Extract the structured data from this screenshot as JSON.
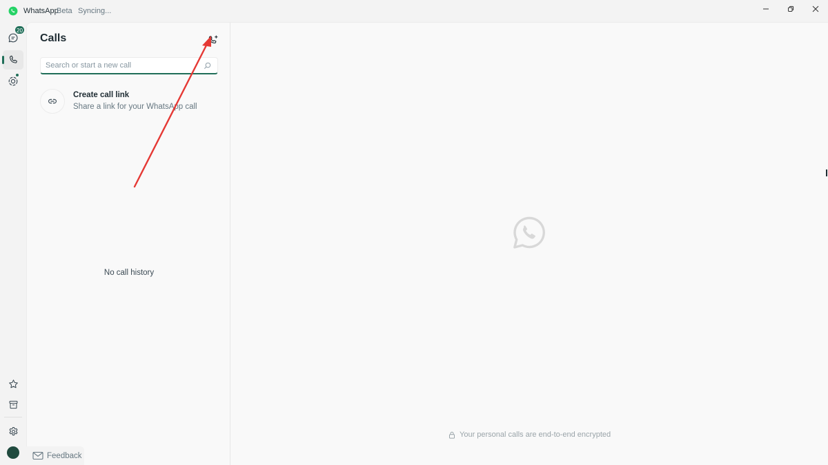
{
  "titlebar": {
    "app_name": "WhatsApp",
    "edition": "Beta",
    "status": "Syncing...",
    "controls": [
      "minimize",
      "restore",
      "close"
    ]
  },
  "rail": {
    "items": [
      {
        "name": "chats",
        "icon": "chat-icon",
        "badge": "20",
        "active": false
      },
      {
        "name": "calls",
        "icon": "phone-icon",
        "active": true
      },
      {
        "name": "status",
        "icon": "status-icon",
        "dot": true,
        "active": false
      }
    ],
    "bottom": [
      {
        "name": "starred",
        "icon": "star-icon"
      },
      {
        "name": "archived",
        "icon": "archive-icon"
      },
      {
        "name": "settings",
        "icon": "gear-icon"
      },
      {
        "name": "profile",
        "icon": "avatar"
      }
    ]
  },
  "calls_panel": {
    "title": "Calls",
    "new_call_icon": "phone-plus-icon",
    "search": {
      "value": "",
      "placeholder": "Search or start a new call"
    },
    "create_link": {
      "title": "Create call link",
      "subtitle": "Share a link for your WhatsApp call",
      "icon": "link-icon"
    },
    "empty_text": "No call history"
  },
  "feedback": {
    "label": "Feedback",
    "icon": "mail-icon"
  },
  "main": {
    "placeholder_icon": "whatsapp-logo-icon",
    "encryption_notice": "Your personal calls are end-to-end encrypted",
    "encryption_icon": "lock-icon"
  },
  "colors": {
    "accent": "#1f6e58",
    "brand_green": "#25d366",
    "annotation_red": "#e53935"
  }
}
